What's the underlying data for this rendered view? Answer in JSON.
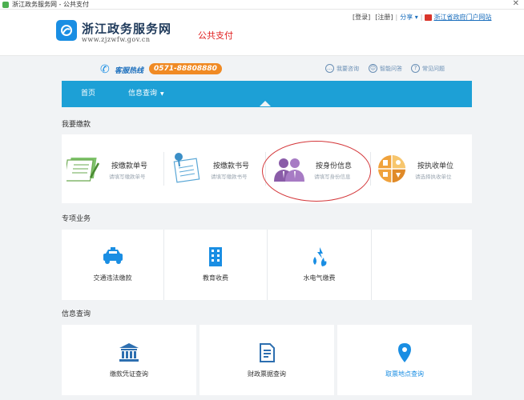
{
  "window": {
    "title": "浙江政务服务网 - 公共支付",
    "close_glyph": "✕"
  },
  "header": {
    "site_name": "浙江政务服务网",
    "site_domain": "www.zjzwfw.gov.cn",
    "section": "公共支付",
    "links": {
      "login": "[登录]",
      "register": "[注册]",
      "share": "分享",
      "portal": "浙江省政府门户网站"
    }
  },
  "hotline": {
    "label": "客服热线",
    "number": "0571-88808880",
    "links": [
      {
        "label": "我要咨询",
        "icon": "chat-icon"
      },
      {
        "label": "智能问答",
        "icon": "robot-icon"
      },
      {
        "label": "常见问题",
        "icon": "question-icon"
      }
    ]
  },
  "nav": {
    "items": [
      {
        "label": "首页"
      },
      {
        "label": "信息查询",
        "has_dropdown": true
      }
    ]
  },
  "pay_section": {
    "title": "我要缴款",
    "cards": [
      {
        "title": "按缴款单号",
        "subtitle": "请填写缴款单号",
        "icon": "form-icon"
      },
      {
        "title": "按缴款书号",
        "subtitle": "请填写缴款书号",
        "icon": "document-pin-icon"
      },
      {
        "title": "按身份信息",
        "subtitle": "请填写身份信息",
        "icon": "people-icon"
      },
      {
        "title": "按执收单位",
        "subtitle": "请选择执收单位",
        "icon": "building-pie-icon"
      }
    ]
  },
  "special_section": {
    "title": "专项业务",
    "cards": [
      {
        "label": "交通违法缴款",
        "icon": "police-car-icon"
      },
      {
        "label": "教育收费",
        "icon": "school-building-icon"
      },
      {
        "label": "水电气缴费",
        "icon": "utilities-icon"
      },
      {
        "label": "",
        "icon": ""
      }
    ]
  },
  "info_section": {
    "title": "信息查询",
    "cards": [
      {
        "label": "缴款凭证查询",
        "icon": "bank-icon"
      },
      {
        "label": "财政票据查询",
        "icon": "receipt-icon"
      },
      {
        "label": "取票地点查询",
        "icon": "location-pin-icon"
      }
    ]
  },
  "colors": {
    "nav_blue": "#1da0d6",
    "hotline_orange": "#f08a24",
    "highlight_red": "#d4373a",
    "icon_blue": "#1a8ee3"
  }
}
